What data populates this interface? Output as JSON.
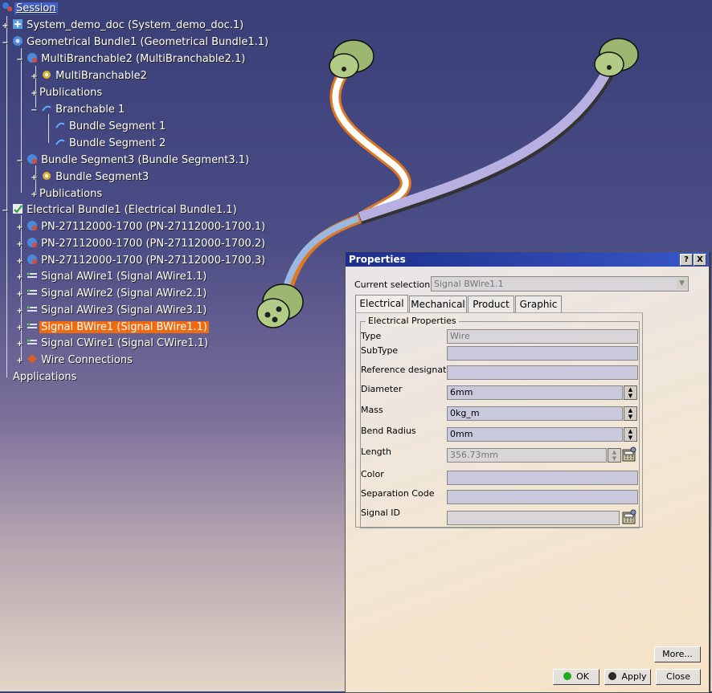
{
  "tree": {
    "items": [
      {
        "label": "Session",
        "level": 0
      },
      {
        "label": "System_demo_doc (System_demo_doc.1)",
        "level": 1
      },
      {
        "label": "Geometrical Bundle1 (Geometrical Bundle1.1)",
        "level": 1
      },
      {
        "label": "MultiBranchable2 (MultiBranchable2.1)",
        "level": 2
      },
      {
        "label": "MultiBranchable2",
        "level": 3
      },
      {
        "label": "Publications",
        "level": 3
      },
      {
        "label": "Branchable 1",
        "level": 3
      },
      {
        "label": "Bundle Segment 1",
        "level": 4
      },
      {
        "label": "Bundle Segment 2",
        "level": 4
      },
      {
        "label": "Bundle Segment3 (Bundle Segment3.1)",
        "level": 2
      },
      {
        "label": "Bundle Segment3",
        "level": 3
      },
      {
        "label": "Publications",
        "level": 3
      },
      {
        "label": "Electrical Bundle1 (Electrical Bundle1.1)",
        "level": 1
      },
      {
        "label": "PN-27112000-1700 (PN-27112000-1700.1)",
        "level": 2
      },
      {
        "label": "PN-27112000-1700 (PN-27112000-1700.2)",
        "level": 2
      },
      {
        "label": "PN-27112000-1700 (PN-27112000-1700.3)",
        "level": 2
      },
      {
        "label": "Signal AWire1 (Signal AWire1.1)",
        "level": 2
      },
      {
        "label": "Signal AWire2 (Signal AWire2.1)",
        "level": 2
      },
      {
        "label": "Signal AWire3 (Signal AWire3.1)",
        "level": 2
      },
      {
        "label": "Signal BWire1 (Signal BWire1.1)",
        "level": 2,
        "selected": true
      },
      {
        "label": "Signal CWire1 (Signal CWire1.1)",
        "level": 2
      },
      {
        "label": "Wire Connections",
        "level": 2
      },
      {
        "label": "Applications",
        "level": 1
      }
    ]
  },
  "dialog": {
    "title": "Properties",
    "help_btn": "?",
    "close_btn": "X",
    "current_selection_label": "Current selection :",
    "current_selection_value": "Signal BWire1.1",
    "tabs": [
      "Electrical",
      "Mechanical",
      "Product",
      "Graphic"
    ],
    "group_label": "Electrical Properties",
    "fields": {
      "type": {
        "label": "Type",
        "value": "Wire"
      },
      "subtype": {
        "label": "SubType",
        "value": ""
      },
      "refdes": {
        "label": "Reference designator",
        "value": ""
      },
      "diameter": {
        "label": "Diameter",
        "value": "6mm"
      },
      "mass": {
        "label": "Mass",
        "value": "0kg_m"
      },
      "bend": {
        "label": "Bend Radius",
        "value": "0mm"
      },
      "length": {
        "label": "Length",
        "value": "356.73mm"
      },
      "color": {
        "label": "Color",
        "value": ""
      },
      "sepcode": {
        "label": "Separation Code",
        "value": ""
      },
      "signalid": {
        "label": "Signal ID",
        "value": ""
      }
    },
    "more_btn": "More...",
    "ok_btn": "OK",
    "apply_btn": "Apply",
    "close_label": "Close"
  },
  "colors": {
    "selection": "#f06a10",
    "title_bar": "#1e2f8a",
    "ok_dot": "#22aa22",
    "apply_dot": "#2a2a2a"
  }
}
